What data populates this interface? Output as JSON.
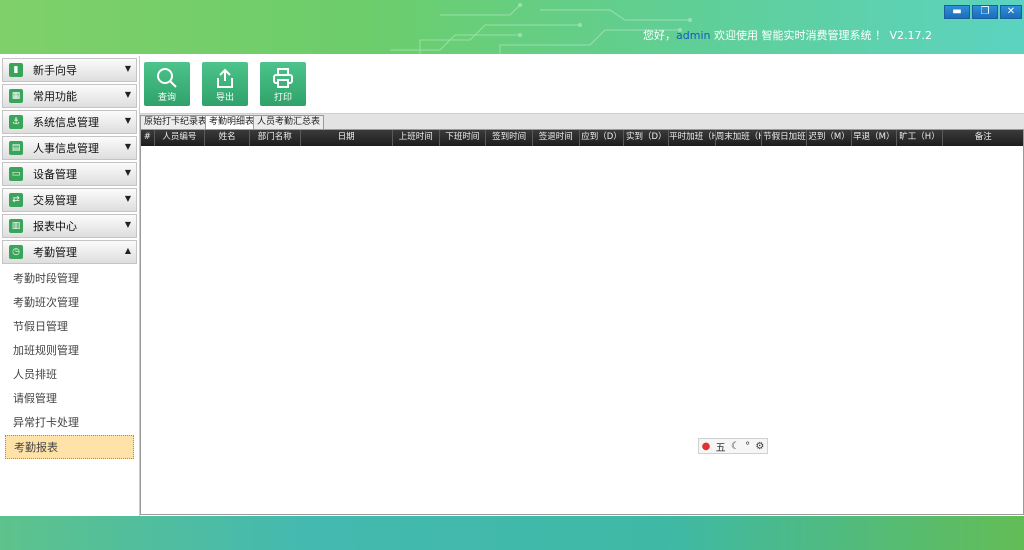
{
  "header": {
    "welcome_prefix": "您好，",
    "user": "admin",
    "welcome_suffix": " 欢迎使用 智能实时消费管理系统 ！ V2.17.2",
    "window_buttons": [
      "minimize",
      "restore",
      "close"
    ]
  },
  "sidebar": {
    "menus": [
      {
        "label": "新手向导",
        "icon": "book-icon",
        "expanded": false
      },
      {
        "label": "常用功能",
        "icon": "grid-icon",
        "expanded": false
      },
      {
        "label": "系统信息管理",
        "icon": "anchor-icon",
        "expanded": false
      },
      {
        "label": "人事信息管理",
        "icon": "id-card-icon",
        "expanded": false
      },
      {
        "label": "设备管理",
        "icon": "monitor-icon",
        "expanded": false
      },
      {
        "label": "交易管理",
        "icon": "transaction-icon",
        "expanded": false
      },
      {
        "label": "报表中心",
        "icon": "bar-chart-icon",
        "expanded": false
      },
      {
        "label": "考勤管理",
        "icon": "clock-icon",
        "expanded": true
      }
    ],
    "sub_items": [
      "考勤时段管理",
      "考勤班次管理",
      "节假日管理",
      "加班规则管理",
      "人员排班",
      "请假管理",
      "异常打卡处理",
      "考勤报表"
    ],
    "active_sub_item": "考勤报表"
  },
  "toolbar": {
    "query_label": "查询",
    "export_label": "导出",
    "print_label": "打印"
  },
  "tabs": [
    {
      "label": "原始打卡纪录表",
      "active": false
    },
    {
      "label": "考勤明细表",
      "active": true
    },
    {
      "label": "人员考勤汇总表",
      "active": false
    }
  ],
  "grid": {
    "columns": [
      "#",
      "人员编号",
      "姓名",
      "部门名称",
      "日期",
      "上班时间",
      "下班时间",
      "签到时间",
      "签退时间",
      "应到（D）",
      "实到（D）",
      "平时加班（H",
      "周末加班（H",
      "节假日加班",
      "迟到（M）",
      "早退（M）",
      "旷工（H）",
      "备注"
    ],
    "rows": []
  },
  "ime": {
    "mode_label": "五"
  },
  "colors": {
    "header_start": "#7fd06a",
    "header_end": "#5cd3c0",
    "button_green": "#2fa26a",
    "active_item_bg": "#ffe2a8",
    "grid_header_bg": "#2a2a2a"
  }
}
